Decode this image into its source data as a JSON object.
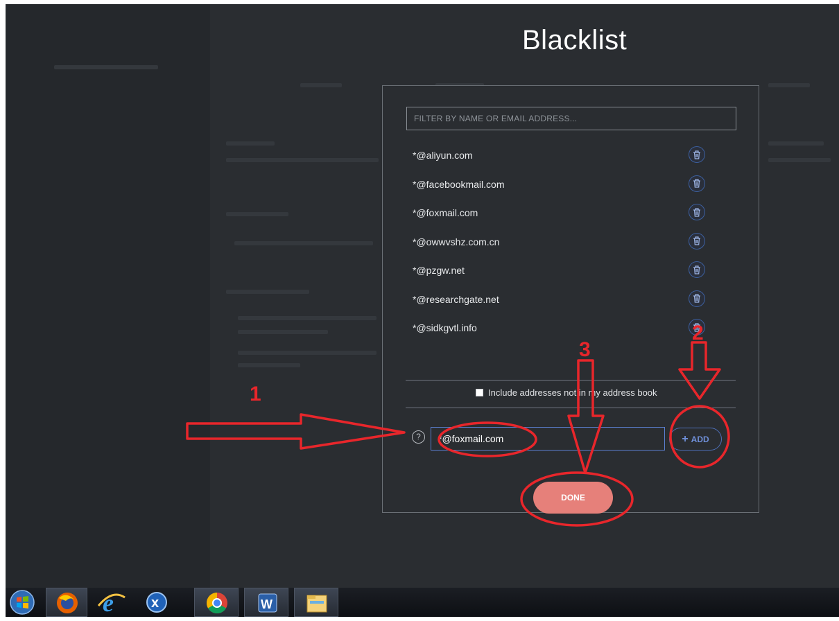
{
  "dialog": {
    "title": "Blacklist",
    "filter_placeholder": "FILTER BY NAME OR EMAIL ADDRESS...",
    "entries": [
      "*@aliyun.com",
      "*@facebookmail.com",
      "*@foxmail.com",
      "*@owwvshz.com.cn",
      "*@pzgw.net",
      "*@researchgate.net",
      "*@sidkgvtl.info"
    ],
    "include_checkbox_label": "Include addresses not in my address book",
    "include_checked": false,
    "info_icon": "?",
    "add_input_value": "*@foxmail.com",
    "add_button_label": "ADD",
    "done_button_label": "DONE"
  },
  "annotations": {
    "labels": [
      "1",
      "2",
      "3"
    ],
    "color": "#e8262b"
  },
  "colors": {
    "background": "#2a2d31",
    "accent_blue": "#5b7fcf",
    "done_button": "#e6807a"
  },
  "taskbar": {
    "icons": [
      "windows-start-icon",
      "firefox-icon",
      "internet-explorer-icon",
      "xmind-icon",
      "chrome-icon",
      "word-icon",
      "file-explorer-icon"
    ]
  }
}
